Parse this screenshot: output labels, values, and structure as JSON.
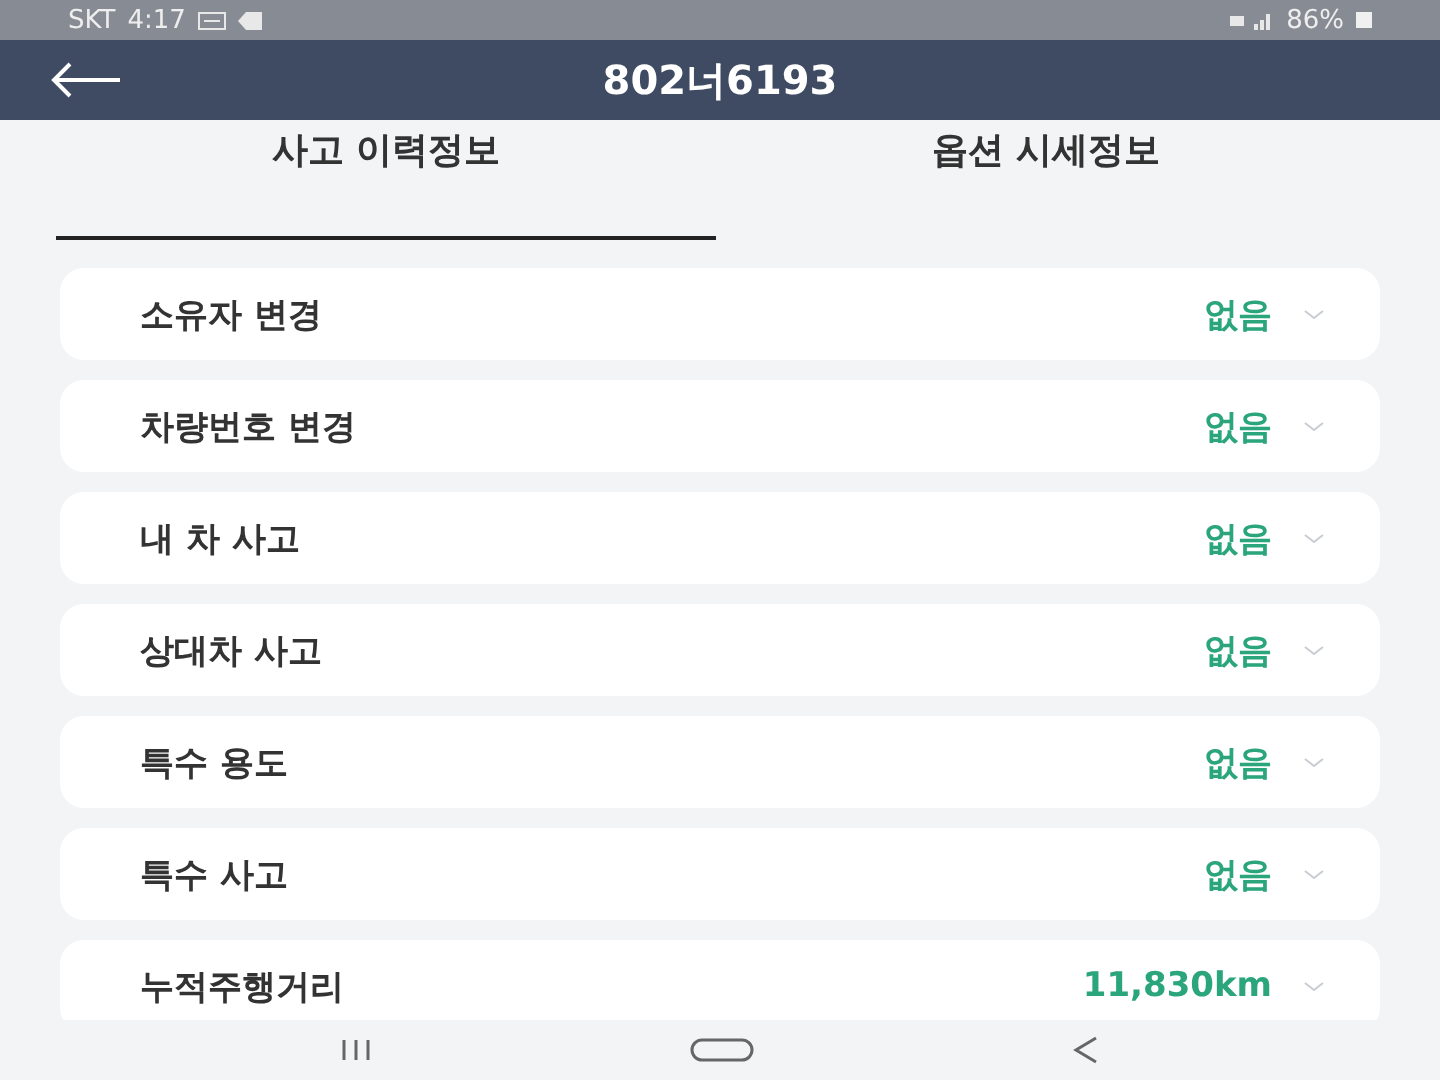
{
  "status_bar": {
    "carrier": "SKT",
    "time": "4:17",
    "battery": "86%"
  },
  "header": {
    "title": "802너6193"
  },
  "tabs": [
    {
      "label": "사고 이력정보",
      "selected": true
    },
    {
      "label": "옵션 시세정보",
      "selected": false
    }
  ],
  "rows": [
    {
      "label": "소유자 변경",
      "value": "없음"
    },
    {
      "label": "차량번호 변경",
      "value": "없음"
    },
    {
      "label": "내 차 사고",
      "value": "없음"
    },
    {
      "label": "상대차 사고",
      "value": "없음"
    },
    {
      "label": "특수 용도",
      "value": "없음"
    },
    {
      "label": "특수 사고",
      "value": "없음"
    },
    {
      "label": "누적주행거리",
      "value": "11,830km"
    }
  ]
}
